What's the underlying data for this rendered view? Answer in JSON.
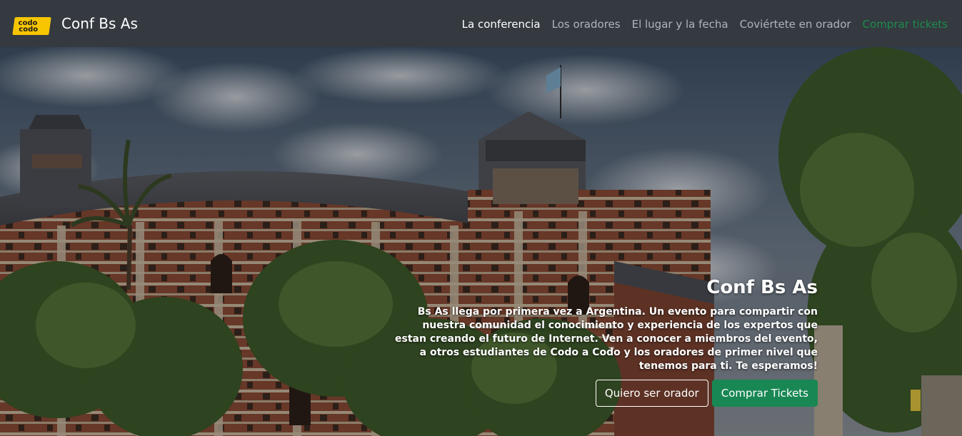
{
  "brand": {
    "logo_line1": "codo",
    "logo_line2": "codo",
    "title": "Conf Bs As"
  },
  "nav": {
    "items": [
      {
        "label": "La conferencia",
        "active": true
      },
      {
        "label": "Los oradores"
      },
      {
        "label": "El lugar y la fecha"
      },
      {
        "label": "Coviértete en orador"
      },
      {
        "label": "Comprar tickets"
      }
    ]
  },
  "hero": {
    "title": "Conf Bs As",
    "text": "Bs As llega por primera vez a Argentina. Un evento para compartir con nuestra comunidad el conocimiento y experiencia de los expertos que estan creando el futuro de Internet. Ven a conocer a miembros del evento, a otros estudiantes de Codo a Codo y los oradores de primer nivel que tenemos para ti. Te esperamos!",
    "buttons": {
      "speaker": "Quiero ser orador",
      "tickets": "Comprar Tickets"
    }
  },
  "colors": {
    "navbar": "#343a40",
    "accent_green": "#198754",
    "logo_yellow": "#f7c600"
  }
}
